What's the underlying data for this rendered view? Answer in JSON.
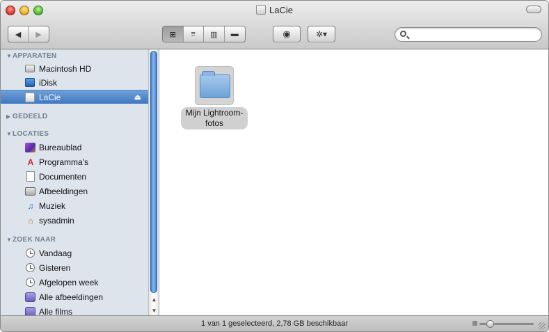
{
  "window": {
    "title": "LaCie"
  },
  "toolbar": {
    "nav": {
      "back_glyph": "◀",
      "forward_glyph": "▶"
    },
    "views": [
      {
        "name": "icon-view",
        "glyph": "⊞",
        "active": true
      },
      {
        "name": "list-view",
        "glyph": "≡",
        "active": false
      },
      {
        "name": "column-view",
        "glyph": "▥",
        "active": false
      },
      {
        "name": "coverflow-view",
        "glyph": "▬",
        "active": false
      }
    ],
    "quicklook_glyph": "◉",
    "action_glyph": "✲▾",
    "search": {
      "value": "",
      "placeholder": ""
    }
  },
  "sidebar": {
    "sections": [
      {
        "key": "apparaten",
        "label": "APPARATEN",
        "expanded": true
      },
      {
        "key": "gedeeld",
        "label": "GEDEELD",
        "expanded": false
      },
      {
        "key": "locaties",
        "label": "LOCATIES",
        "expanded": true
      },
      {
        "key": "zoek_naar",
        "label": "ZOEK NAAR",
        "expanded": true
      }
    ],
    "items": [
      {
        "label": "Macintosh HD",
        "icon": "hard-drive-icon"
      },
      {
        "label": "iDisk",
        "icon": "idisk-icon"
      },
      {
        "label": "LaCie",
        "icon": "external-drive-icon",
        "selected": true
      },
      {
        "label": "Bureaublad",
        "icon": "desktop-icon"
      },
      {
        "label": "Programma's",
        "icon": "applications-icon"
      },
      {
        "label": "Documenten",
        "icon": "documents-icon"
      },
      {
        "label": "Afbeeldingen",
        "icon": "pictures-icon"
      },
      {
        "label": "Muziek",
        "icon": "music-icon"
      },
      {
        "label": "sysadmin",
        "icon": "home-icon"
      },
      {
        "label": "Vandaag",
        "icon": "clock-icon"
      },
      {
        "label": "Gisteren",
        "icon": "clock-icon"
      },
      {
        "label": "Afgelopen week",
        "icon": "clock-icon"
      },
      {
        "label": "Alle afbeeldingen",
        "icon": "smart-folder-icon"
      },
      {
        "label": "Alle films",
        "icon": "smart-folder-icon"
      }
    ],
    "eject_glyph": "⏏"
  },
  "content": {
    "items": [
      {
        "label": "Mijn Lightroom-fotos",
        "label_line1": "Mijn Lightroom-",
        "label_line2": "fotos",
        "selected": true
      }
    ]
  },
  "status": {
    "text": "1 van 1 geselecteerd, 2,78 GB beschikbaar",
    "icon_size_level": 0.15
  },
  "colors": {
    "sidebar_bg": "#dde4ec",
    "selection": "#3e78c2",
    "section_header": "#6f7d8c"
  }
}
